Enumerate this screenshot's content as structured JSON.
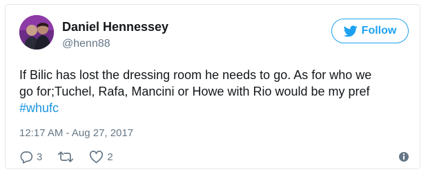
{
  "author": {
    "name": "Daniel Hennessey",
    "handle": "@henn88",
    "avatar_icon": "profile-photo"
  },
  "follow_button": {
    "label": "Follow",
    "icon": "bird-icon",
    "color": "#1da1f2"
  },
  "tweet": {
    "line1": "If Bilic has lost the dressing room he needs to go. As for who we",
    "line2": "go for;Tuchel, Rafa, Mancini or Howe with Rio would be my pref",
    "hashtag": "#whufc",
    "hashtag_color": "#1b95e0"
  },
  "timestamp": "12:17 AM - Aug 27, 2017",
  "actions": {
    "reply": {
      "icon": "reply-icon",
      "count": "3"
    },
    "retweet": {
      "icon": "retweet-icon"
    },
    "like": {
      "icon": "heart-icon",
      "count": "2"
    },
    "info": {
      "icon": "info-icon"
    }
  }
}
